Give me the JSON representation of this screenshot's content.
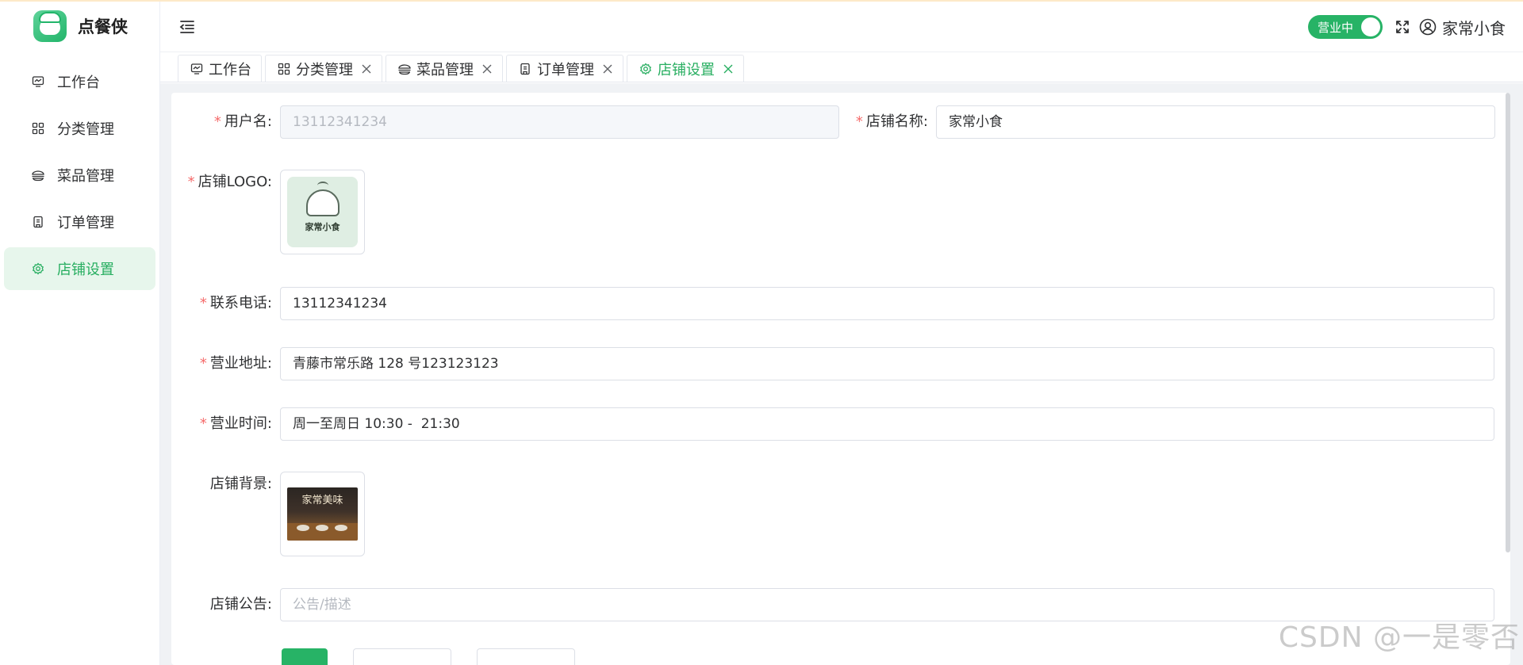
{
  "app": {
    "name": "点餐侠"
  },
  "sidebar": {
    "items": [
      {
        "label": "工作台",
        "icon": "monitor-icon",
        "active": false
      },
      {
        "label": "分类管理",
        "icon": "grid-icon",
        "active": false
      },
      {
        "label": "菜品管理",
        "icon": "bowl-icon",
        "active": false
      },
      {
        "label": "订单管理",
        "icon": "receipt-icon",
        "active": false
      },
      {
        "label": "店铺设置",
        "icon": "gear-icon",
        "active": true
      }
    ]
  },
  "header": {
    "status_switch_label": "营业中",
    "user_name": "家常小食"
  },
  "tabs": [
    {
      "label": "工作台",
      "closable": false
    },
    {
      "label": "分类管理",
      "closable": true
    },
    {
      "label": "菜品管理",
      "closable": true
    },
    {
      "label": "订单管理",
      "closable": true
    },
    {
      "label": "店铺设置",
      "closable": true,
      "active": true
    }
  ],
  "form": {
    "username": {
      "label": "用户名:",
      "value": "13112341234",
      "required": true,
      "disabled": true
    },
    "shop_name": {
      "label": "店铺名称:",
      "value": "家常小食",
      "required": true
    },
    "logo": {
      "label": "店铺LOGO:",
      "required": true,
      "image_caption": "家常小食"
    },
    "phone": {
      "label": "联系电话:",
      "value": "13112341234",
      "required": true
    },
    "address": {
      "label": "营业地址:",
      "value": "青藤市常乐路 128 号123123123",
      "required": true
    },
    "hours": {
      "label": "营业时间:",
      "value": "周一至周日 10:30 -  21:30",
      "required": true
    },
    "background": {
      "label": "店铺背景:",
      "required": false,
      "image_title": "家常美味"
    },
    "notice": {
      "label": "店铺公告:",
      "placeholder": "公告/描述",
      "required": false
    }
  },
  "watermark": "CSDN @一是零否",
  "colors": {
    "accent": "#27b366",
    "active_bg": "#e7f6ec",
    "required": "#f56c6c"
  }
}
